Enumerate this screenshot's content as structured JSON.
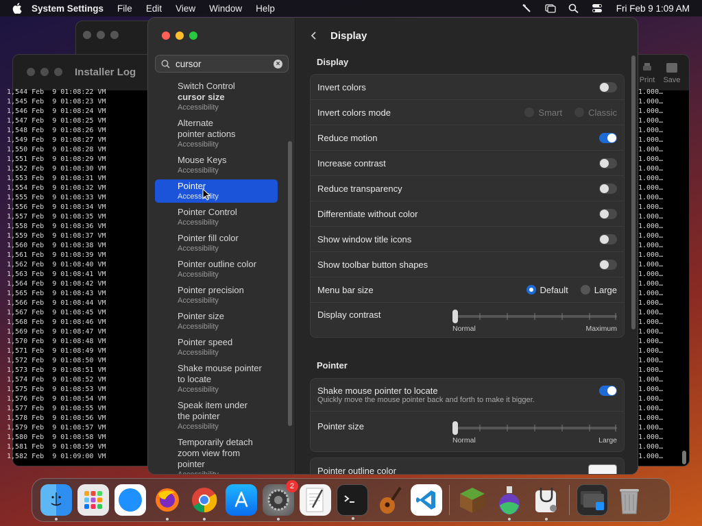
{
  "menubar": {
    "app_name": "System Settings",
    "items": [
      "File",
      "Edit",
      "View",
      "Window",
      "Help"
    ],
    "clock": "Fri Feb 9  1:09 AM"
  },
  "installer_log": {
    "title": "Installer Log",
    "lines": [
      "1,544 Feb  9 01:08:22 VM",
      "1,545 Feb  9 01:08:23 VM",
      "1,546 Feb  9 01:08:24 VM",
      "1,547 Feb  9 01:08:25 VM",
      "1,548 Feb  9 01:08:26 VM",
      "1,549 Feb  9 01:08:27 VM",
      "1,550 Feb  9 01:08:28 VM",
      "1,551 Feb  9 01:08:29 VM",
      "1,552 Feb  9 01:08:30 VM",
      "1,553 Feb  9 01:08:31 VM",
      "1,554 Feb  9 01:08:32 VM",
      "1,555 Feb  9 01:08:33 VM",
      "1,556 Feb  9 01:08:34 VM",
      "1,557 Feb  9 01:08:35 VM",
      "1,558 Feb  9 01:08:36 VM",
      "1,559 Feb  9 01:08:37 VM",
      "1,560 Feb  9 01:08:38 VM",
      "1,561 Feb  9 01:08:39 VM",
      "1,562 Feb  9 01:08:40 VM",
      "1,563 Feb  9 01:08:41 VM",
      "1,564 Feb  9 01:08:42 VM",
      "1,565 Feb  9 01:08:43 VM",
      "1,566 Feb  9 01:08:44 VM",
      "1,567 Feb  9 01:08:45 VM",
      "1,568 Feb  9 01:08:46 VM",
      "1,569 Feb  9 01:08:47 VM",
      "1,570 Feb  9 01:08:48 VM",
      "1,571 Feb  9 01:08:49 VM",
      "1,572 Feb  9 01:08:50 VM",
      "1,573 Feb  9 01:08:51 VM",
      "1,574 Feb  9 01:08:52 VM",
      "1,575 Feb  9 01:08:53 VM",
      "1,576 Feb  9 01:08:54 VM",
      "1,577 Feb  9 01:08:55 VM",
      "1,578 Feb  9 01:08:56 VM",
      "1,579 Feb  9 01:08:57 VM",
      "1,580 Feb  9 01:08:58 VM",
      "1,581 Feb  9 01:08:59 VM",
      "1,582 Feb  9 01:09:00 VM"
    ],
    "right_value": "1.000…",
    "toolbar": {
      "print_label": "Print",
      "save_label": "Save"
    }
  },
  "settings": {
    "search_value": "cursor",
    "results": [
      {
        "title": "Switch Control",
        "title2": "cursor size",
        "sub": "Accessibility"
      },
      {
        "title": "Alternate",
        "title2": "pointer actions",
        "sub": "Accessibility"
      },
      {
        "title": "Mouse Keys",
        "title2": "",
        "sub": "Accessibility"
      },
      {
        "title": "Pointer",
        "title2": "",
        "sub": "Accessibility"
      },
      {
        "title": "Pointer Control",
        "title2": "",
        "sub": "Accessibility"
      },
      {
        "title": "Pointer fill color",
        "title2": "",
        "sub": "Accessibility"
      },
      {
        "title": "Pointer outline color",
        "title2": "",
        "sub": "Accessibility"
      },
      {
        "title": "Pointer precision",
        "title2": "",
        "sub": "Accessibility"
      },
      {
        "title": "Pointer size",
        "title2": "",
        "sub": "Accessibility"
      },
      {
        "title": "Pointer speed",
        "title2": "",
        "sub": "Accessibility"
      },
      {
        "title": "Shake mouse pointer",
        "title2": "to locate",
        "sub": "Accessibility"
      },
      {
        "title": "Speak item under",
        "title2": "the pointer",
        "sub": "Accessibility"
      },
      {
        "title": "Temporarily detach",
        "title2": "zoom view from",
        "title3": "pointer",
        "sub": "Accessibility"
      }
    ],
    "page_title": "Display",
    "display_section": {
      "header": "Display",
      "invert_colors": "Invert colors",
      "invert_mode": "Invert colors mode",
      "smart": "Smart",
      "classic": "Classic",
      "reduce_motion": "Reduce motion",
      "increase_contrast": "Increase contrast",
      "reduce_transparency": "Reduce transparency",
      "differentiate": "Differentiate without color",
      "title_icons": "Show window title icons",
      "toolbar_shapes": "Show toolbar button shapes",
      "menu_bar_size": "Menu bar size",
      "default": "Default",
      "large": "Large",
      "display_contrast": "Display contrast",
      "normal": "Normal",
      "maximum": "Maximum"
    },
    "pointer_section": {
      "header": "Pointer",
      "shake": "Shake mouse pointer to locate",
      "shake_desc": "Quickly move the mouse pointer back and forth to make it bigger.",
      "pointer_size": "Pointer size",
      "normal": "Normal",
      "large": "Large",
      "outline_color": "Pointer outline color"
    },
    "toggles": {
      "invert_colors": false,
      "reduce_motion": true,
      "increase_contrast": false,
      "reduce_transparency": false,
      "differentiate": false,
      "title_icons": false,
      "toolbar_shapes": false,
      "shake": true
    },
    "display_contrast_level": 0,
    "pointer_size_level": 0
  },
  "dock": {
    "settings_badge": "2",
    "apps": [
      "finder",
      "launchpad",
      "safari",
      "firefox",
      "chrome",
      "app-store",
      "system-settings",
      "textedit",
      "terminal",
      "garageband",
      "vscode",
      "minecraft",
      "disk-utility",
      "disk-utility-2",
      "preview",
      "trash"
    ]
  }
}
